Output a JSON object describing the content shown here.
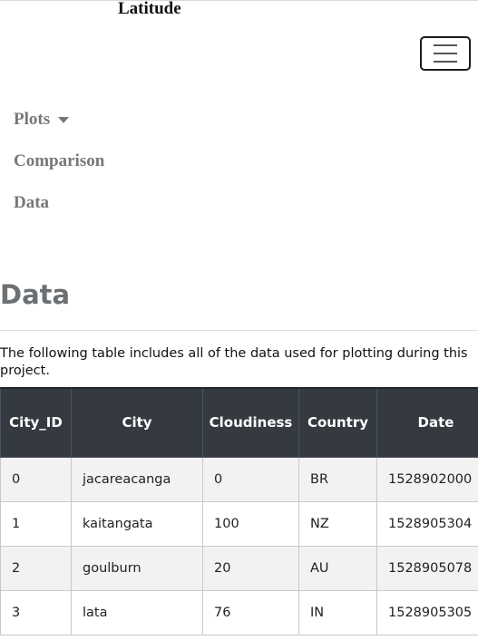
{
  "navbar": {
    "brand": "Latitude",
    "toggler_icon": "hamburger-icon",
    "links": [
      {
        "label": "Plots",
        "has_dropdown": true,
        "dropdown_icon": "caret-down-icon"
      },
      {
        "label": "Comparison"
      },
      {
        "label": "Data"
      }
    ]
  },
  "page": {
    "title": "Data",
    "intro": "The following table includes all of the data used for plotting during this project."
  },
  "table": {
    "headers": [
      "City_ID",
      "City",
      "Cloudiness",
      "Country",
      "Date"
    ],
    "rows": [
      [
        "0",
        "jacareacanga",
        "0",
        "BR",
        "1528902000"
      ],
      [
        "1",
        "kaitangata",
        "100",
        "NZ",
        "1528905304"
      ],
      [
        "2",
        "goulburn",
        "20",
        "AU",
        "1528905078"
      ],
      [
        "3",
        "lata",
        "76",
        "IN",
        "1528905305"
      ]
    ]
  },
  "colors": {
    "table_header_bg": "#343a40",
    "nav_link": "#777777",
    "title": "#6c6f73",
    "striped_row": "#f2f2f2"
  }
}
